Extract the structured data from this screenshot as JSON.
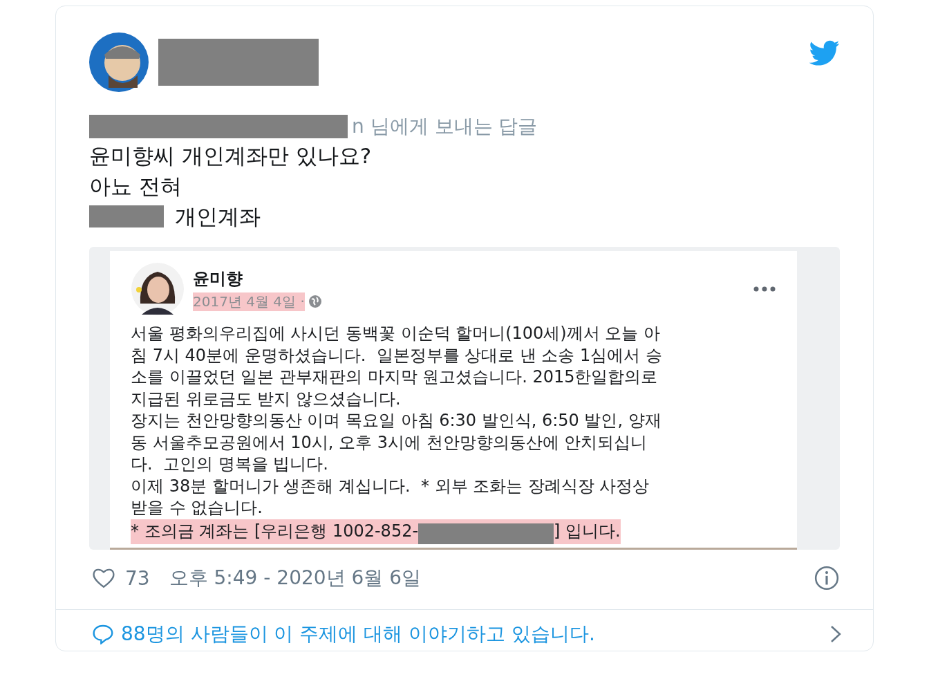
{
  "tweet": {
    "reply_to": "n 님에게 보내는 답글",
    "lines": [
      {
        "text": "윤미향씨 개인계좌만 있나요?",
        "redacted_prefix": false
      },
      {
        "text": "아뇨 전혀",
        "redacted_prefix": false
      },
      {
        "text": "개인계좌",
        "redacted_prefix": true
      }
    ],
    "embedded_post": {
      "author": "윤미향",
      "date": "2017년 4월 4일 ·",
      "date_highlighted": true,
      "lines": [
        {
          "text": "서울 평화의우리집에 사시던 동백꽃 이순덕 할머니(100세)께서 오늘 아",
          "highlighted": false
        },
        {
          "text": "침 7시 40분에 운명하셨습니다.  일본정부를 상대로 낸 소송 1심에서 승",
          "highlighted": false
        },
        {
          "text": "소를 이끌었던 일본 관부재판의 마지막 원고셨습니다. 2015한일합의로",
          "highlighted": false
        },
        {
          "text": "지급된 위로금도 받지 않으셨습니다.",
          "highlighted": false
        },
        {
          "text": "장지는 천안망향의동산 이며 목요일 아침 6:30 발인식, 6:50 발인, 양재",
          "highlighted": false
        },
        {
          "text": "동 서울추모공원에서 10시, 오후 3시에 천안망향의동산에 안치되십니",
          "highlighted": false
        },
        {
          "text": "다.  고인의 명복을 빕니다.",
          "highlighted": false
        },
        {
          "text": "이제 38분 할머니가 생존해 계십니다.  * 외부 조화는 장례식장 사정상",
          "highlighted": false
        },
        {
          "text": "받을 수 없습니다.",
          "highlighted": false
        }
      ],
      "account_line": {
        "before": "* 조의금 계좌는 [우리은행 1002-852-",
        "after": "] 입니다.",
        "highlighted": true
      }
    },
    "likes": "73",
    "timestamp": "오후 5:49 - 2020년 6월 6일",
    "conversation_link": "88명의 사람들이 이 주제에 대해 이야기하고 있습니다."
  }
}
